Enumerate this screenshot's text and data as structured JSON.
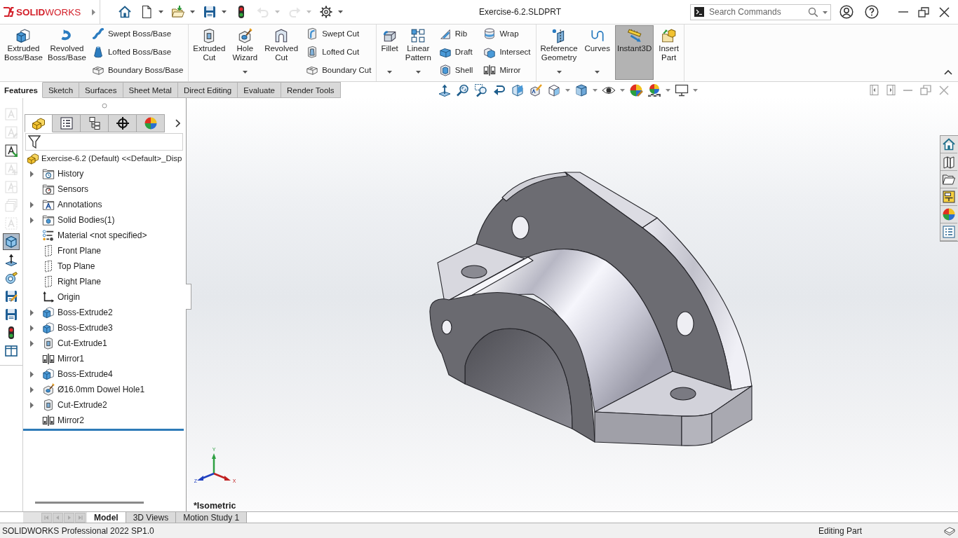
{
  "app": {
    "logo": "**SOLID**WORKS"
  },
  "quick_access": [
    {
      "kind": "home",
      "dropdown": false,
      "disabled": false
    },
    {
      "kind": "new",
      "dropdown": true,
      "disabled": false
    },
    {
      "kind": "open",
      "dropdown": true,
      "disabled": false
    },
    {
      "kind": "save",
      "dropdown": true,
      "disabled": false
    },
    {
      "kind": "rebuild",
      "dropdown": false,
      "disabled": false
    },
    {
      "kind": "undo",
      "dropdown": true,
      "disabled": true
    },
    {
      "kind": "redo",
      "dropdown": true,
      "disabled": true
    },
    {
      "kind": "options",
      "dropdown": true,
      "disabled": false
    }
  ],
  "window": {
    "title": "Exercise-6.2.SLDPRT"
  },
  "search": {
    "placeholder": "Search Commands"
  },
  "ribbon": {
    "groups": [
      {
        "items": [
          {
            "label": "Extruded Boss/Base",
            "kind": "large",
            "dropdown": false,
            "pressed": false
          },
          {
            "label": "Revolved Boss/Base",
            "kind": "large",
            "dropdown": false,
            "pressed": false
          },
          {
            "label": "Swept Boss/Base",
            "kind": "small",
            "dropdown": false,
            "pressed": false
          },
          {
            "label": "Lofted Boss/Base",
            "kind": "small",
            "dropdown": false,
            "pressed": false
          },
          {
            "label": "Boundary Boss/Base",
            "kind": "small",
            "dropdown": false,
            "pressed": false
          }
        ]
      },
      {
        "items": [
          {
            "label": "Extruded Cut",
            "kind": "large",
            "dropdown": false,
            "pressed": false
          },
          {
            "label": "Hole Wizard",
            "kind": "large",
            "dropdown": true,
            "pressed": false
          },
          {
            "label": "Revolved Cut",
            "kind": "large",
            "dropdown": false,
            "pressed": false
          },
          {
            "label": "Swept Cut",
            "kind": "small",
            "dropdown": false,
            "pressed": false
          },
          {
            "label": "Lofted Cut",
            "kind": "small",
            "dropdown": false,
            "pressed": false
          },
          {
            "label": "Boundary Cut",
            "kind": "small",
            "dropdown": false,
            "pressed": false
          }
        ]
      },
      {
        "items": [
          {
            "label": "Fillet",
            "kind": "large",
            "dropdown": true,
            "pressed": false
          },
          {
            "label": "Linear Pattern",
            "kind": "large",
            "dropdown": true,
            "pressed": false
          },
          {
            "label": "Rib",
            "kind": "small",
            "dropdown": false,
            "pressed": false
          },
          {
            "label": "Draft",
            "kind": "small",
            "dropdown": false,
            "pressed": false
          },
          {
            "label": "Shell",
            "kind": "small",
            "dropdown": false,
            "pressed": false
          },
          {
            "label": "Wrap",
            "kind": "small",
            "dropdown": false,
            "pressed": false
          },
          {
            "label": "Intersect",
            "kind": "small",
            "dropdown": false,
            "pressed": false
          },
          {
            "label": "Mirror",
            "kind": "small",
            "dropdown": false,
            "pressed": false
          }
        ]
      },
      {
        "items": [
          {
            "label": "Reference Geometry",
            "kind": "large",
            "dropdown": true,
            "pressed": false
          },
          {
            "label": "Curves",
            "kind": "large",
            "dropdown": true,
            "pressed": false
          },
          {
            "label": "Instant3D",
            "kind": "large",
            "dropdown": false,
            "pressed": true
          },
          {
            "label": "Insert Part",
            "kind": "large",
            "dropdown": false,
            "pressed": false
          }
        ]
      }
    ]
  },
  "command_tabs": [
    {
      "label": "Features",
      "selected": true
    },
    {
      "label": "Sketch",
      "selected": false
    },
    {
      "label": "Surfaces",
      "selected": false
    },
    {
      "label": "Sheet Metal",
      "selected": false
    },
    {
      "label": "Direct Editing",
      "selected": false
    },
    {
      "label": "Evaluate",
      "selected": false
    },
    {
      "label": "Render Tools",
      "selected": false
    }
  ],
  "left_toolbar": [
    {
      "kind": "letter",
      "disabled": true,
      "selected": false
    },
    {
      "kind": "letter-pencil",
      "disabled": true,
      "selected": false
    },
    {
      "kind": "letter-arrow",
      "disabled": false,
      "selected": false
    },
    {
      "kind": "letter-plus",
      "disabled": true,
      "selected": false
    },
    {
      "kind": "letter-tag",
      "disabled": true,
      "selected": false
    },
    {
      "kind": "pages",
      "disabled": true,
      "selected": false
    },
    {
      "kind": "letter-dashed",
      "disabled": true,
      "selected": false
    },
    {
      "kind": "cube",
      "disabled": false,
      "selected": true
    },
    {
      "kind": "normal",
      "disabled": false,
      "selected": false
    },
    {
      "kind": "measure",
      "disabled": false,
      "selected": false
    },
    {
      "kind": "save-edit",
      "disabled": false,
      "selected": false
    },
    {
      "kind": "save",
      "disabled": false,
      "selected": false
    },
    {
      "kind": "rebuild",
      "disabled": false,
      "selected": false
    },
    {
      "kind": "split",
      "disabled": false,
      "selected": false
    }
  ],
  "feature_manager": {
    "tabs": [
      {
        "selected": true
      },
      {
        "selected": false
      },
      {
        "selected": false
      },
      {
        "selected": false
      },
      {
        "selected": false
      }
    ],
    "tree": {
      "label": "Exercise-6.2 (Default) <<Default>_Disp",
      "kind": "part",
      "children": [
        {
          "label": "History",
          "kind": "history",
          "expander": true
        },
        {
          "label": "Sensors",
          "kind": "sensors",
          "expander": false
        },
        {
          "label": "Annotations",
          "kind": "annotations",
          "expander": true
        },
        {
          "label": "Solid Bodies(1)",
          "kind": "bodies",
          "expander": true
        },
        {
          "label": "Material <not specified>",
          "kind": "material",
          "expander": false
        },
        {
          "label": "Front Plane",
          "kind": "plane",
          "expander": false
        },
        {
          "label": "Top Plane",
          "kind": "plane",
          "expander": false
        },
        {
          "label": "Right Plane",
          "kind": "plane",
          "expander": false
        },
        {
          "label": "Origin",
          "kind": "origin",
          "expander": false
        },
        {
          "label": "Boss-Extrude2",
          "kind": "boss",
          "expander": true
        },
        {
          "label": "Boss-Extrude3",
          "kind": "boss",
          "expander": true
        },
        {
          "label": "Cut-Extrude1",
          "kind": "cut",
          "expander": true
        },
        {
          "label": "Mirror1",
          "kind": "mirror",
          "expander": false
        },
        {
          "label": "Boss-Extrude4",
          "kind": "boss",
          "expander": true
        },
        {
          "label": "Ø16.0mm Dowel Hole1",
          "kind": "hole",
          "expander": true
        },
        {
          "label": "Cut-Extrude2",
          "kind": "cut",
          "expander": true
        },
        {
          "label": "Mirror2",
          "kind": "mirror",
          "expander": false
        }
      ]
    }
  },
  "viewport": {
    "triad_labels": [
      "Y",
      "X",
      "Z"
    ],
    "view_name": "*Isometric"
  },
  "view_tabs": {
    "scroll_buttons": [
      {
        "kind": "first",
        "disabled": true
      },
      {
        "kind": "previous",
        "disabled": true
      },
      {
        "kind": "next",
        "disabled": true
      },
      {
        "kind": "last",
        "disabled": true
      }
    ],
    "tabs": [
      {
        "label": "Model",
        "selected": true
      },
      {
        "label": "3D Views",
        "selected": false
      },
      {
        "label": "Motion Study 1",
        "selected": false
      }
    ]
  },
  "status_bar": {
    "product": "SOLIDWORKS Professional 2022 SP1.0",
    "mode": "Editing Part"
  }
}
